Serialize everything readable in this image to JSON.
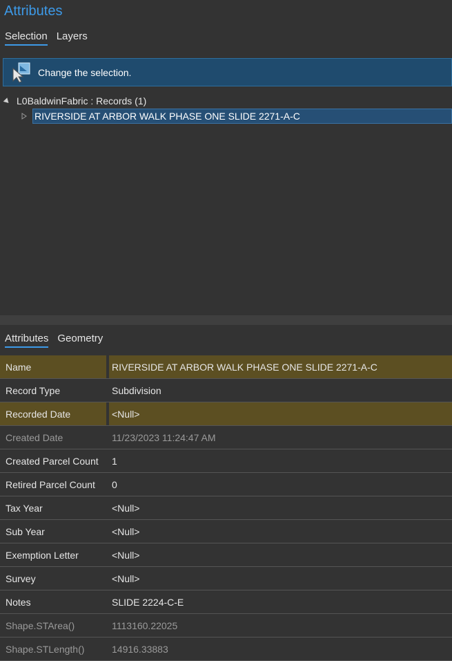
{
  "panel_title": "Attributes",
  "top_tabs": [
    {
      "label": "Selection",
      "active": true
    },
    {
      "label": "Layers",
      "active": false
    }
  ],
  "banner": {
    "text": "Change the selection.",
    "icon": "select-cursor-icon"
  },
  "tree": {
    "root_label": "L0BaldwinFabric : Records (1)",
    "child_label": "RIVERSIDE AT ARBOR WALK PHASE ONE SLIDE 2271-A-C"
  },
  "bottom_tabs": [
    {
      "label": "Attributes",
      "active": true
    },
    {
      "label": "Geometry",
      "active": false
    }
  ],
  "attributes": [
    {
      "name": "Name",
      "value": "RIVERSIDE AT ARBOR WALK PHASE ONE SLIDE 2271-A-C",
      "highlight": true,
      "readonly": false
    },
    {
      "name": "Record Type",
      "value": "Subdivision",
      "highlight": false,
      "readonly": false
    },
    {
      "name": "Recorded Date",
      "value": "<Null>",
      "highlight": true,
      "readonly": false
    },
    {
      "name": "Created Date",
      "value": "11/23/2023 11:24:47 AM",
      "highlight": false,
      "readonly": true
    },
    {
      "name": "Created Parcel Count",
      "value": "1",
      "highlight": false,
      "readonly": false
    },
    {
      "name": "Retired Parcel Count",
      "value": "0",
      "highlight": false,
      "readonly": false
    },
    {
      "name": "Tax Year",
      "value": "<Null>",
      "highlight": false,
      "readonly": false
    },
    {
      "name": "Sub Year",
      "value": "<Null>",
      "highlight": false,
      "readonly": false
    },
    {
      "name": "Exemption Letter",
      "value": "<Null>",
      "highlight": false,
      "readonly": false
    },
    {
      "name": "Survey",
      "value": "<Null>",
      "highlight": false,
      "readonly": false
    },
    {
      "name": "Notes",
      "value": "SLIDE 2224-C-E",
      "highlight": false,
      "readonly": false
    },
    {
      "name": "Shape.STArea()",
      "value": "1113160.22025",
      "highlight": false,
      "readonly": true
    },
    {
      "name": "Shape.STLength()",
      "value": "14916.33883",
      "highlight": false,
      "readonly": true
    }
  ],
  "colors": {
    "accent": "#3d9ae8",
    "highlight_row": "#5c4f22",
    "banner": "#1f4b6e",
    "selected_row": "#264f75"
  }
}
